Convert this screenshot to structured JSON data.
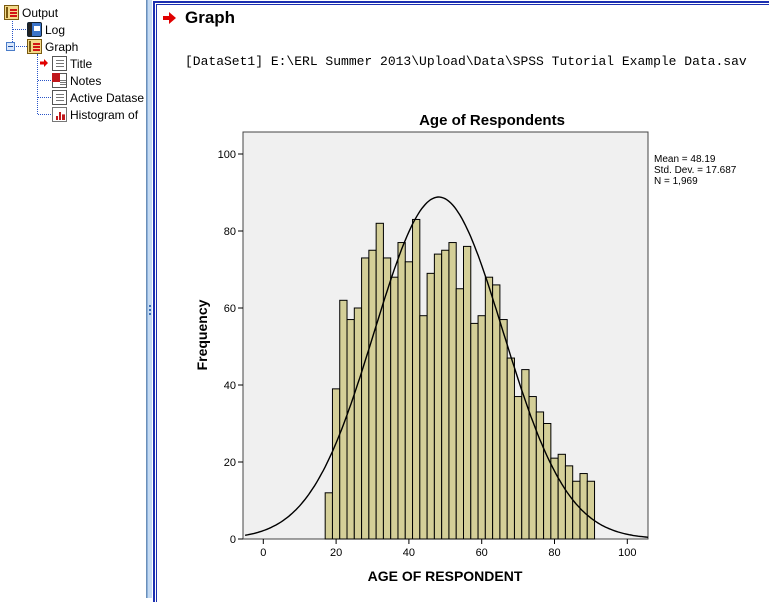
{
  "outline": {
    "items": [
      {
        "label": "Output",
        "icon": "output-book-icon"
      },
      {
        "label": "Log",
        "icon": "log-icon"
      },
      {
        "label": "Graph",
        "icon": "graph-book-icon",
        "expanded": true
      },
      {
        "label": "Title",
        "icon": "title-doc-icon",
        "selected_arrow": true
      },
      {
        "label": "Notes",
        "icon": "notes-icon"
      },
      {
        "label": "Active Datase",
        "icon": "active-dataset-icon"
      },
      {
        "label": "Histogram of",
        "icon": "histogram-icon"
      }
    ]
  },
  "content": {
    "heading": "Graph",
    "dataset_line": "[DataSet1] E:\\ERL Summer 2013\\Upload\\Data\\SPSS Tutorial Example Data.sav"
  },
  "colors": {
    "bar_fill": "#d4cf98",
    "bar_stroke": "#000000",
    "plot_bg": "#f0f0f0",
    "accent_arrow": "#e00000",
    "frame_blue": "#1b2fb0"
  },
  "chart_data": {
    "type": "bar",
    "subtype": "histogram-with-normal-curve",
    "title": "Age of Respondents",
    "xlabel": "AGE OF RESPONDENT",
    "ylabel": "Frequency",
    "xlim": [
      -5,
      106
    ],
    "ylim": [
      0,
      105
    ],
    "xticks": [
      0,
      20,
      40,
      60,
      80,
      100
    ],
    "yticks": [
      0,
      20,
      40,
      60,
      80,
      100
    ],
    "bin_start": 17,
    "bin_width": 2,
    "values": [
      12,
      39,
      62,
      57,
      60,
      73,
      75,
      82,
      73,
      68,
      77,
      72,
      83,
      58,
      69,
      74,
      75,
      77,
      65,
      76,
      56,
      58,
      68,
      66,
      57,
      47,
      37,
      44,
      37,
      33,
      30,
      21,
      22,
      19,
      15,
      17,
      15
    ],
    "normal_curve": {
      "mean": 48.19,
      "sd": 17.687,
      "n": 1969
    },
    "stats_legend": [
      "Mean = 48.19",
      "Std. Dev. = 17.687",
      "N = 1,969"
    ],
    "grid": false,
    "legend_position": "top-right"
  }
}
